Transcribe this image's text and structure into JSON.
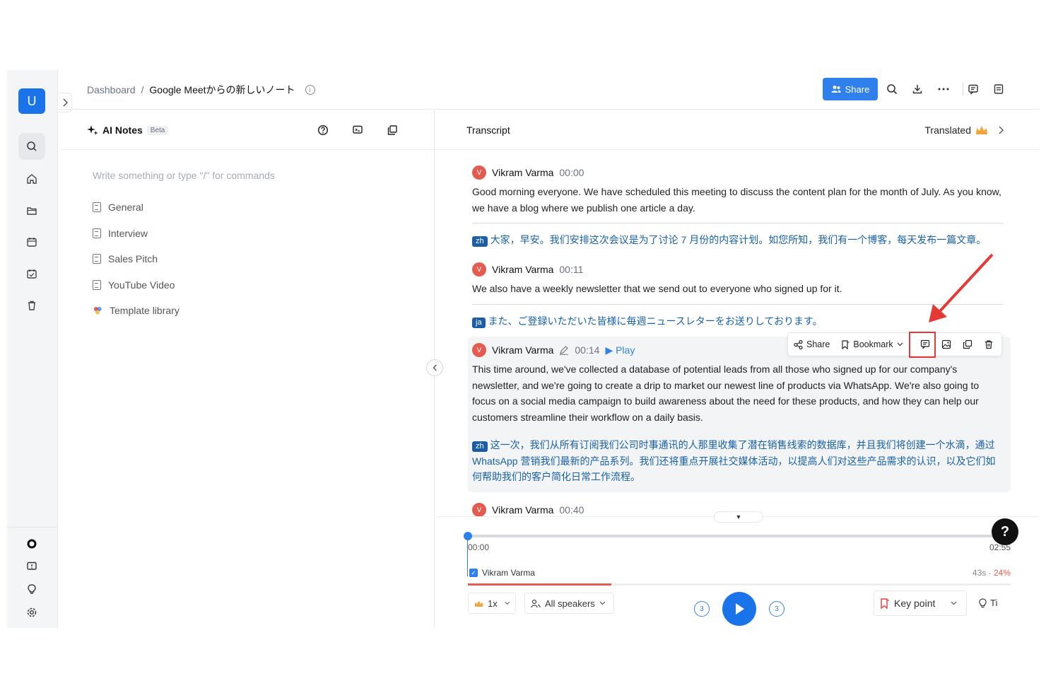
{
  "rail": {
    "avatar_letter": "U",
    "top_icons": [
      "search-icon",
      "home-icon",
      "folder-icon",
      "calendar-icon",
      "calendar-check-icon",
      "trash-icon"
    ],
    "bottom_icons": [
      "brand-icon",
      "feedback-icon",
      "lightbulb-icon",
      "settings-icon"
    ]
  },
  "header": {
    "breadcrumb_root": "Dashboard",
    "breadcrumb_sep": "/",
    "breadcrumb_current": "Google Meetからの新しいノート",
    "share_label": "Share"
  },
  "notes": {
    "title": "AI Notes",
    "beta": "Beta",
    "placeholder": "Write something or type \"/\" for commands",
    "templates": [
      "General",
      "Interview",
      "Sales Pitch",
      "YouTube Video",
      "Template library"
    ]
  },
  "transcript": {
    "title": "Transcript",
    "translated_label": "Translated",
    "segments": [
      {
        "avatar": "V",
        "speaker": "Vikram Varma",
        "time": "00:00",
        "text": "Good morning everyone. We have scheduled this meeting to discuss the content plan for the month of July. As you know, we have a blog where we publish one article a day.",
        "lang": "zh",
        "translation": "大家，早安。我们安排这次会议是为了讨论 7 月份的内容计划。如您所知，我们有一个博客，每天发布一篇文章。"
      },
      {
        "avatar": "V",
        "speaker": "Vikram Varma",
        "time": "00:11",
        "text": "We also have a weekly newsletter that we send out to everyone who signed up for it.",
        "lang": "ja",
        "translation": "また、ご登録いただいた皆様に毎週ニュースレターをお送りしております。"
      },
      {
        "avatar": "V",
        "speaker": "Vikram Varma",
        "time": "00:14",
        "play_label": "Play",
        "text": "This time around, we've collected a database of potential leads from all those who signed up for our company's newsletter, and we're going to create a drip to market our newest line of products via WhatsApp. We're also going to focus on a social media campaign to build awareness about the need for these products, and how they can help our customers streamline their workflow on a daily basis.",
        "lang": "zh",
        "translation": "这一次，我们从所有订阅我们公司时事通讯的人那里收集了潜在销售线索的数据库，并且我们将创建一个水滴，通过 WhatsApp 营销我们最新的产品系列。我们还将重点开展社交媒体活动，以提高人们对这些产品需求的认识，以及它们如何帮助我们的客户简化日常工作流程。"
      },
      {
        "avatar": "V",
        "speaker": "Vikram Varma",
        "time": "00:40"
      }
    ],
    "toolbar": {
      "share_label": "Share",
      "bookmark_label": "Bookmark"
    }
  },
  "player": {
    "current_time": "00:00",
    "duration": "02:55",
    "progress": 0,
    "speaker": "Vikram Varma",
    "speaker_duration": "43s",
    "speaker_sep": "·",
    "speaker_percent": "24%",
    "speaker_share": 0.24,
    "speed": "1x",
    "speakers_filter": "All speakers",
    "skip_back": "3",
    "skip_forward": "3",
    "key_point_label": "Key point",
    "tips_label": "Ti"
  },
  "help_label": "?",
  "colors": {
    "accent": "#2f80ed",
    "speaker_red": "#e45b4f",
    "translation_blue": "#1761a8",
    "highlight_red": "#e53935"
  }
}
